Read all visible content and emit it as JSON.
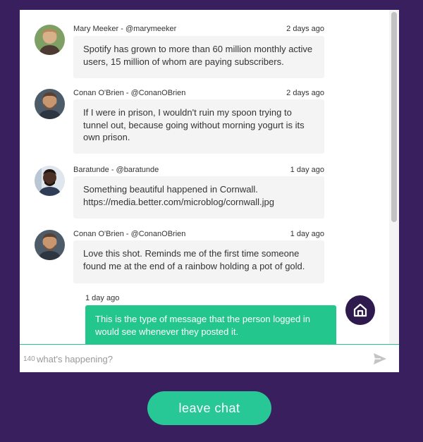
{
  "messages": [
    {
      "author": "Mary Meeker - @marymeeker",
      "time": "2 days ago",
      "text": "Spotify has grown to more than 60 million monthly active users, 15 million of whom are paying subscribers."
    },
    {
      "author": "Conan O'Brien - @ConanOBrien",
      "time": "2 days ago",
      "text": "If I were in prison, I wouldn't ruin my spoon trying to tunnel out, because going without morning yogurt is its own prison."
    },
    {
      "author": "Baratunde - @baratunde",
      "time": "1 day ago",
      "text": "Something beautiful happened in Cornwall. https://media.better.com/microblog/cornwall.jpg"
    },
    {
      "author": "Conan O'Brien - @ConanOBrien",
      "time": "1 day ago",
      "text": "Love this shot. Reminds me of the first time someone found me at the end of a rainbow holding a pot of gold."
    }
  ],
  "own_message": {
    "time": "1 day ago",
    "text": "This is the type of message that the person logged in would see whenever they posted it."
  },
  "composer": {
    "counter": "140",
    "placeholder": "what's happening?"
  },
  "leave_button": "leave chat",
  "colors": {
    "background": "#3a1f5e",
    "accent": "#23c68d",
    "bubble": "#f4f4f4"
  }
}
